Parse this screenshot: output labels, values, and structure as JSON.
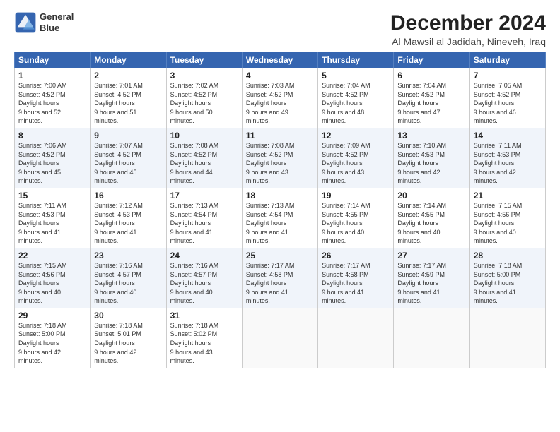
{
  "logo": {
    "line1": "General",
    "line2": "Blue"
  },
  "title": "December 2024",
  "subtitle": "Al Mawsil al Jadidah, Nineveh, Iraq",
  "days": [
    "Sunday",
    "Monday",
    "Tuesday",
    "Wednesday",
    "Thursday",
    "Friday",
    "Saturday"
  ],
  "weeks": [
    [
      {
        "day": "1",
        "sunrise": "7:00 AM",
        "sunset": "4:52 PM",
        "daylight": "9 hours and 52 minutes."
      },
      {
        "day": "2",
        "sunrise": "7:01 AM",
        "sunset": "4:52 PM",
        "daylight": "9 hours and 51 minutes."
      },
      {
        "day": "3",
        "sunrise": "7:02 AM",
        "sunset": "4:52 PM",
        "daylight": "9 hours and 50 minutes."
      },
      {
        "day": "4",
        "sunrise": "7:03 AM",
        "sunset": "4:52 PM",
        "daylight": "9 hours and 49 minutes."
      },
      {
        "day": "5",
        "sunrise": "7:04 AM",
        "sunset": "4:52 PM",
        "daylight": "9 hours and 48 minutes."
      },
      {
        "day": "6",
        "sunrise": "7:04 AM",
        "sunset": "4:52 PM",
        "daylight": "9 hours and 47 minutes."
      },
      {
        "day": "7",
        "sunrise": "7:05 AM",
        "sunset": "4:52 PM",
        "daylight": "9 hours and 46 minutes."
      }
    ],
    [
      {
        "day": "8",
        "sunrise": "7:06 AM",
        "sunset": "4:52 PM",
        "daylight": "9 hours and 45 minutes."
      },
      {
        "day": "9",
        "sunrise": "7:07 AM",
        "sunset": "4:52 PM",
        "daylight": "9 hours and 45 minutes."
      },
      {
        "day": "10",
        "sunrise": "7:08 AM",
        "sunset": "4:52 PM",
        "daylight": "9 hours and 44 minutes."
      },
      {
        "day": "11",
        "sunrise": "7:08 AM",
        "sunset": "4:52 PM",
        "daylight": "9 hours and 43 minutes."
      },
      {
        "day": "12",
        "sunrise": "7:09 AM",
        "sunset": "4:52 PM",
        "daylight": "9 hours and 43 minutes."
      },
      {
        "day": "13",
        "sunrise": "7:10 AM",
        "sunset": "4:53 PM",
        "daylight": "9 hours and 42 minutes."
      },
      {
        "day": "14",
        "sunrise": "7:11 AM",
        "sunset": "4:53 PM",
        "daylight": "9 hours and 42 minutes."
      }
    ],
    [
      {
        "day": "15",
        "sunrise": "7:11 AM",
        "sunset": "4:53 PM",
        "daylight": "9 hours and 41 minutes."
      },
      {
        "day": "16",
        "sunrise": "7:12 AM",
        "sunset": "4:53 PM",
        "daylight": "9 hours and 41 minutes."
      },
      {
        "day": "17",
        "sunrise": "7:13 AM",
        "sunset": "4:54 PM",
        "daylight": "9 hours and 41 minutes."
      },
      {
        "day": "18",
        "sunrise": "7:13 AM",
        "sunset": "4:54 PM",
        "daylight": "9 hours and 41 minutes."
      },
      {
        "day": "19",
        "sunrise": "7:14 AM",
        "sunset": "4:55 PM",
        "daylight": "9 hours and 40 minutes."
      },
      {
        "day": "20",
        "sunrise": "7:14 AM",
        "sunset": "4:55 PM",
        "daylight": "9 hours and 40 minutes."
      },
      {
        "day": "21",
        "sunrise": "7:15 AM",
        "sunset": "4:56 PM",
        "daylight": "9 hours and 40 minutes."
      }
    ],
    [
      {
        "day": "22",
        "sunrise": "7:15 AM",
        "sunset": "4:56 PM",
        "daylight": "9 hours and 40 minutes."
      },
      {
        "day": "23",
        "sunrise": "7:16 AM",
        "sunset": "4:57 PM",
        "daylight": "9 hours and 40 minutes."
      },
      {
        "day": "24",
        "sunrise": "7:16 AM",
        "sunset": "4:57 PM",
        "daylight": "9 hours and 40 minutes."
      },
      {
        "day": "25",
        "sunrise": "7:17 AM",
        "sunset": "4:58 PM",
        "daylight": "9 hours and 41 minutes."
      },
      {
        "day": "26",
        "sunrise": "7:17 AM",
        "sunset": "4:58 PM",
        "daylight": "9 hours and 41 minutes."
      },
      {
        "day": "27",
        "sunrise": "7:17 AM",
        "sunset": "4:59 PM",
        "daylight": "9 hours and 41 minutes."
      },
      {
        "day": "28",
        "sunrise": "7:18 AM",
        "sunset": "5:00 PM",
        "daylight": "9 hours and 41 minutes."
      }
    ],
    [
      {
        "day": "29",
        "sunrise": "7:18 AM",
        "sunset": "5:00 PM",
        "daylight": "9 hours and 42 minutes."
      },
      {
        "day": "30",
        "sunrise": "7:18 AM",
        "sunset": "5:01 PM",
        "daylight": "9 hours and 42 minutes."
      },
      {
        "day": "31",
        "sunrise": "7:18 AM",
        "sunset": "5:02 PM",
        "daylight": "9 hours and 43 minutes."
      },
      null,
      null,
      null,
      null
    ]
  ]
}
